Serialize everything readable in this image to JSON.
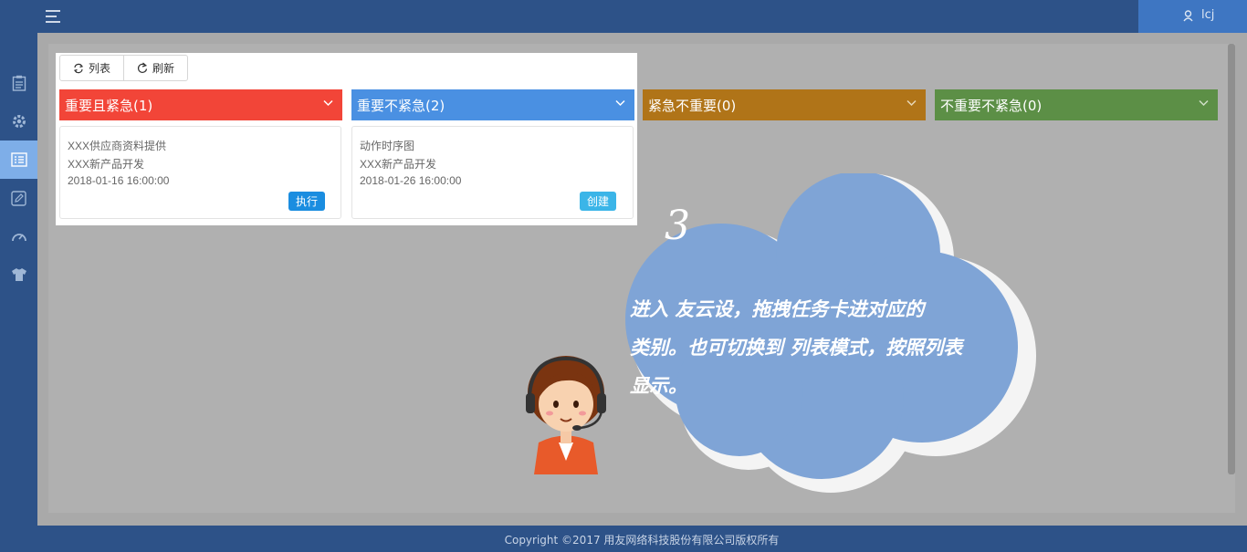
{
  "header": {
    "user_name": "lcj"
  },
  "sidebar": {
    "items": [
      {
        "icon": "clipboard-icon",
        "active": false
      },
      {
        "icon": "gear-icon",
        "active": false
      },
      {
        "icon": "task-list-icon",
        "active": true
      },
      {
        "icon": "edit-icon",
        "active": false
      },
      {
        "icon": "dashboard-icon",
        "active": false
      },
      {
        "icon": "shirt-icon",
        "active": false
      }
    ]
  },
  "toolbar": {
    "list_label": "列表",
    "refresh_label": "刷新"
  },
  "columns": [
    {
      "title": "重要且紧急(1)",
      "color": "#f24538"
    },
    {
      "title": "重要不紧急(2)",
      "color": "#4a90e2"
    },
    {
      "title": "紧急不重要(0)",
      "color": "#b07418"
    },
    {
      "title": "不重要不紧急(0)",
      "color": "#5c8f46"
    }
  ],
  "cards": [
    {
      "line1": "XXX供应商资料提供",
      "line2": "XXX新产品开发",
      "datetime": "2018-01-16 16:00:00",
      "action": "执行",
      "action_color": "#1a8de0"
    },
    {
      "line1": "动作时序图",
      "line2": "XXX新产品开发",
      "datetime": "2018-01-26 16:00:00",
      "action": "创建",
      "action_color": "#3bb5e8"
    }
  ],
  "guide": {
    "step": "3",
    "lines": [
      "进入 友云设，拖拽任务卡进对应的",
      "类别。也可切换到 列表模式，按照列表",
      "显示。"
    ]
  },
  "footer": {
    "copyright": "Copyright ©2017 用友网络科技股份有限公司版权所有"
  }
}
